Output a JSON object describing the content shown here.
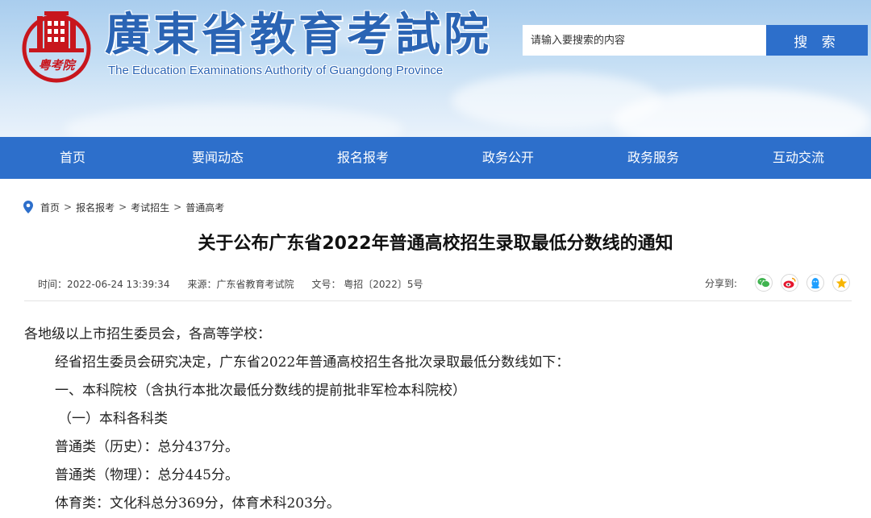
{
  "header": {
    "logo_text": "粤考院",
    "title": "廣東省教育考試院",
    "subtitle": "The Education Examinations Authority of Guangdong Province",
    "search_placeholder": "请输入要搜索的内容",
    "search_button": "搜 索",
    "colors": {
      "brand_blue": "#2d6fcb",
      "logo_red": "#c8161d"
    }
  },
  "nav": {
    "items": [
      {
        "label": "首页"
      },
      {
        "label": "要闻动态"
      },
      {
        "label": "报名报考"
      },
      {
        "label": "政务公开"
      },
      {
        "label": "政务服务"
      },
      {
        "label": "互动交流"
      }
    ]
  },
  "breadcrumb": {
    "items": [
      "首页",
      "报名报考",
      "考试招生",
      "普通高考"
    ],
    "separator": ">"
  },
  "article": {
    "title": "关于公布广东省2022年普通高校招生录取最低分数线的通知",
    "meta": {
      "time": "时间：2022-06-24 13:39:34",
      "source": "来源：广东省教育考试院",
      "doc_no": "文号： 粤招〔2022〕5号"
    },
    "share": {
      "label": "分享到:",
      "icons": [
        "wechat-icon",
        "weibo-icon",
        "qq-icon",
        "qzone-icon"
      ]
    },
    "paragraphs": [
      "各地级以上市招生委员会，各高等学校：",
      "经省招生委员会研究决定，广东省2022年普通高校招生各批次录取最低分数线如下：",
      "一、本科院校（含执行本批次最低分数线的提前批非军检本科院校）",
      "（一）本科各科类",
      "普通类（历史）：总分437分。",
      "普通类（物理）：总分445分。",
      "体育类：文化科总分369分，体育术科203分。"
    ]
  }
}
